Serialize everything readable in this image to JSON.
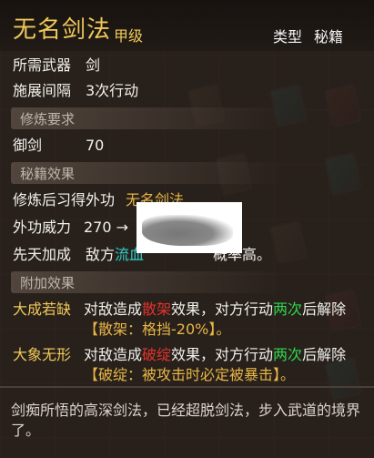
{
  "header": {
    "title": "无名剑法",
    "grade": "甲级",
    "type_label": "类型",
    "category_label": "秘籍"
  },
  "stats": {
    "weapon_label": "所需武器",
    "weapon_value": "剑",
    "interval_label": "施展间隔",
    "interval_value": "3次行动"
  },
  "sections": {
    "training_req": "修炼要求",
    "manual_effect": "秘籍效果",
    "extra_effect": "附加效果"
  },
  "requirements": {
    "skill_label": "御剑",
    "skill_value": "70"
  },
  "effects": {
    "learn_label": "修炼后习得外功",
    "learn_value": "无名剑法",
    "power_label": "外功威力",
    "power_value": "270 →",
    "innate_label": "先天加成",
    "innate_prefix": "敌方",
    "innate_highlight": "流血",
    "innate_suffix": "概率高。"
  },
  "extras": [
    {
      "name": "大成若缺",
      "line1_a": "对敌造成",
      "line1_status": "散架",
      "line1_b": "效果，对方行动",
      "line1_count": "两次",
      "line1_c": "后解除",
      "line2": "【散架：格挡-20%】。"
    },
    {
      "name": "大象无形",
      "line1_a": "对敌造成",
      "line1_status": "破绽",
      "line1_b": "效果，对方行动",
      "line1_count": "两次",
      "line1_c": "后解除",
      "line2": "【破绽：被攻击时必定被暴击】。"
    }
  ],
  "description": "剑痴所悟的高深剑法，已经超脱剑法，步入武道的境界了。"
}
